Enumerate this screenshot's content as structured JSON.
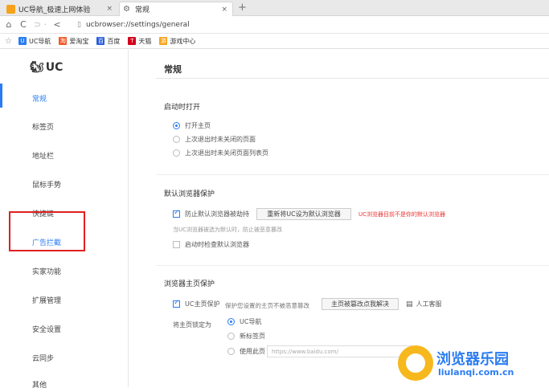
{
  "tabs": [
    {
      "label": "UC导航_极速上网体验",
      "close": "×"
    },
    {
      "label": "常规",
      "close": "×"
    }
  ],
  "newtab": "+",
  "nav": {
    "home": "⌂",
    "refresh": "C",
    "back_menu": "⊃ ·",
    "back": "<",
    "url": "ucbrowser://settings/general"
  },
  "bookmarks": [
    {
      "label": "UC导航",
      "color": "#2b7cf2",
      "glyph": "U"
    },
    {
      "label": "爱淘宝",
      "color": "#f05a28",
      "glyph": "淘"
    },
    {
      "label": "百度",
      "color": "#2b5fd9",
      "glyph": "百"
    },
    {
      "label": "天猫",
      "color": "#d4001c",
      "glyph": "T"
    },
    {
      "label": "游戏中心",
      "color": "#f7a21b",
      "glyph": "游"
    }
  ],
  "sidebar": {
    "logo": "UC",
    "items": [
      {
        "label": "常规",
        "active": true
      },
      {
        "label": "标签页"
      },
      {
        "label": "地址栏"
      },
      {
        "label": "鼠标手势"
      },
      {
        "label": "快捷键"
      },
      {
        "label": "广告拦截"
      },
      {
        "label": "实家功能"
      },
      {
        "label": "扩展管理"
      },
      {
        "label": "安全设置"
      },
      {
        "label": "云同步"
      },
      {
        "label": "其他"
      }
    ]
  },
  "main": {
    "title": "常规",
    "startup": {
      "heading": "启动时打开",
      "options": [
        "打开主页",
        "上次退出时未关闭的页面",
        "上次退出时未关闭页面列表页"
      ],
      "selected": 0
    },
    "default_browser": {
      "heading": "默认浏览器保护",
      "check_label": "防止默认浏览器被劫持",
      "button": "重新将UC设为默认浏览器",
      "warning": "UC浏览器目前不是你的默认浏览器",
      "note": "当UC浏览器被选为默认时，防止被恶意篡改",
      "check2_label": "启动时检查默认浏览器"
    },
    "homepage": {
      "heading": "浏览器主页保护",
      "check_label": "UC主页保护",
      "check_note": "保护您设置的主页不被恶意篡改",
      "button": "主页被篡改点我解决",
      "service": "人工客服",
      "set_label": "将主页锁定为",
      "options": [
        "UC导航",
        "新标签页",
        "使用此页"
      ],
      "selected": 0,
      "url_placeholder": "https://www.baidu.com/"
    }
  },
  "watermark": {
    "line1": "浏览器乐园",
    "line2": "liulanqi.com.cn"
  }
}
